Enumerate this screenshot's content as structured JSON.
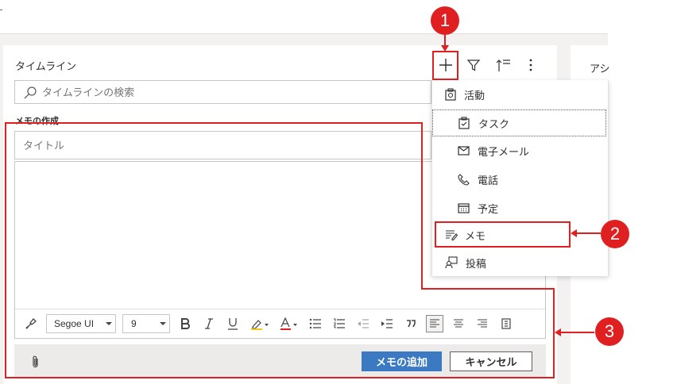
{
  "timeline": {
    "title": "タイムライン",
    "search_placeholder": "タイムラインの検索",
    "right_panel_label": "アシ"
  },
  "note_form": {
    "section_label": "メモの作成",
    "title_placeholder": "タイトル",
    "font_name": "Segoe UI",
    "font_size": "9",
    "add_button": "メモの追加",
    "cancel_button": "キャンセル"
  },
  "add_menu": {
    "items": [
      {
        "label": "活動",
        "icon": "activity-icon"
      },
      {
        "label": "タスク",
        "icon": "task-icon"
      },
      {
        "label": "電子メール",
        "icon": "email-icon"
      },
      {
        "label": "電話",
        "icon": "phone-icon"
      },
      {
        "label": "予定",
        "icon": "calendar-icon"
      },
      {
        "label": "メモ",
        "icon": "note-icon"
      },
      {
        "label": "投稿",
        "icon": "post-icon"
      }
    ]
  },
  "callouts": [
    "1",
    "2",
    "3"
  ],
  "colors": {
    "accent_red": "#e02020",
    "primary_blue": "#3b79c3",
    "border_gray": "#c8c6c4"
  }
}
